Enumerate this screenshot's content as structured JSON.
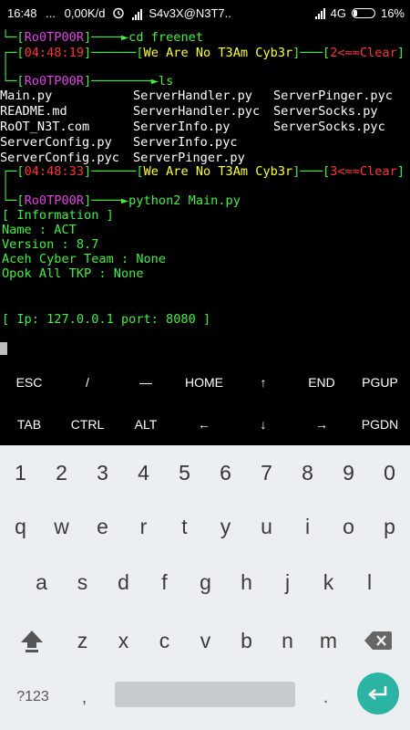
{
  "status_bar": {
    "time": "16:48",
    "dots": "...",
    "speed": "0,00K/d",
    "carrier": "S4v3X@N3T7..",
    "network": "4G",
    "battery": "16%"
  },
  "terminal": {
    "prompt_user": "Ro0TP00R",
    "cmd1": "cd freenet",
    "time1": "04:48:19",
    "banner": "We Are No T3Am Cyb3r",
    "count1": "2<≈≈Clear",
    "cmd2": "ls",
    "files": [
      [
        "Main.py",
        "ServerHandler.py",
        "ServerPinger.pyc"
      ],
      [
        "README.md",
        "ServerHandler.pyc",
        "ServerSocks.py"
      ],
      [
        "RoOT_N3T.com",
        "ServerInfo.py",
        "ServerSocks.pyc"
      ],
      [
        "ServerConfig.py",
        "ServerInfo.pyc",
        ""
      ],
      [
        "ServerConfig.pyc",
        "ServerPinger.py",
        ""
      ]
    ],
    "time2": "04:48:33",
    "count2": "3<≈≈Clear",
    "cmd3": "python2 Main.py",
    "info_header": "[ Information ]",
    "info_name": "Name : ACT",
    "info_version": "Version : 8.7",
    "info_team": "Aceh Cyber Team : None",
    "info_opok": "Opok All TKP : None",
    "ip_line": "[ Ip: 127.0.0.1 port: 8080 ]"
  },
  "extra_keys": {
    "row1": [
      "ESC",
      "/",
      "—",
      "HOME",
      "↑",
      "END",
      "PGUP"
    ],
    "row2": [
      "TAB",
      "CTRL",
      "ALT",
      "←",
      "↓",
      "→",
      "PGDN"
    ]
  },
  "keyboard": {
    "numbers": [
      "1",
      "2",
      "3",
      "4",
      "5",
      "6",
      "7",
      "8",
      "9",
      "0"
    ],
    "row1": [
      "q",
      "w",
      "e",
      "r",
      "t",
      "y",
      "u",
      "i",
      "o",
      "p"
    ],
    "row2": [
      "a",
      "s",
      "d",
      "f",
      "g",
      "h",
      "j",
      "k",
      "l"
    ],
    "row3": [
      "z",
      "x",
      "c",
      "v",
      "b",
      "n",
      "m"
    ],
    "sym_label": "?123",
    "comma": ",",
    "period": "."
  }
}
